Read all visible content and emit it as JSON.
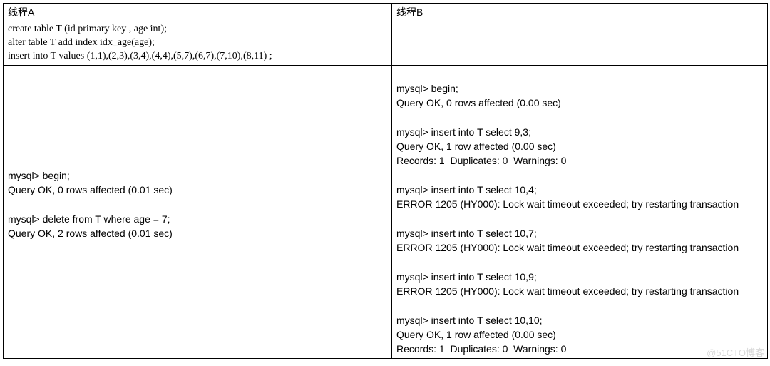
{
  "headers": {
    "colA": "线程A",
    "colB": "线程B"
  },
  "setup": {
    "line1": "create table T (id primary key , age int);",
    "line2": "alter table T add index idx_age(age);",
    "line3": "insert into T values (1,1),(2,3),(3,4),(4,4),(5,7),(6,7),(7,10),(8,11)  ;"
  },
  "threadA": "\n\n\n\n\n\n\nmysql> begin;\nQuery OK, 0 rows affected (0.01 sec)\n\nmysql> delete from T where age = 7;\nQuery OK, 2 rows affected (0.01 sec)\n\n\n\n\n\n\n\n\n",
  "threadB": "\nmysql> begin;\nQuery OK, 0 rows affected (0.00 sec)\n\nmysql> insert into T select 9,3;\nQuery OK, 1 row affected (0.00 sec)\nRecords: 1  Duplicates: 0  Warnings: 0\n\nmysql> insert into T select 10,4;\nERROR 1205 (HY000): Lock wait timeout exceeded; try restarting transaction\n\nmysql> insert into T select 10,7;\nERROR 1205 (HY000): Lock wait timeout exceeded; try restarting transaction\n\nmysql> insert into T select 10,9;\nERROR 1205 (HY000): Lock wait timeout exceeded; try restarting transaction\n\nmysql> insert into T select 10,10;\nQuery OK, 1 row affected (0.00 sec)\nRecords: 1  Duplicates: 0  Warnings: 0",
  "watermark": "@51CTO博客"
}
